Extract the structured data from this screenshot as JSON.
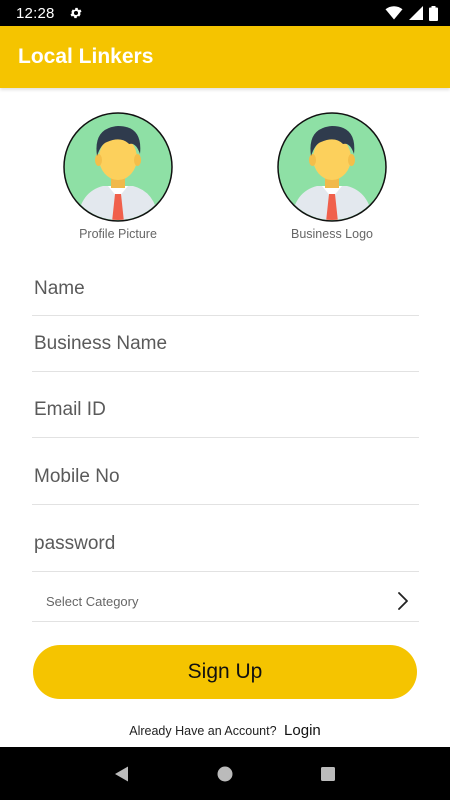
{
  "status_bar": {
    "time": "12:28",
    "icons": [
      "settings-gear-icon",
      "wifi-icon",
      "signal-icon",
      "battery-icon"
    ]
  },
  "app_bar": {
    "title": "Local Linkers",
    "color": "#f5c400"
  },
  "avatars": [
    {
      "label": "Profile Picture",
      "icon": "person-avatar-icon"
    },
    {
      "label": "Business Logo",
      "icon": "person-avatar-icon"
    }
  ],
  "form": {
    "name_placeholder": "Name",
    "business_name_placeholder": "Business Name",
    "email_placeholder": "Email ID",
    "mobile_placeholder": "Mobile No",
    "password_placeholder": "password",
    "category_placeholder": "Select Category"
  },
  "signup_button": {
    "label": "Sign Up"
  },
  "login_prompt": {
    "text": "Already Have an Account?",
    "link": "Login"
  },
  "nav_bar": {
    "buttons": [
      "back-icon",
      "home-icon",
      "recents-icon"
    ]
  }
}
